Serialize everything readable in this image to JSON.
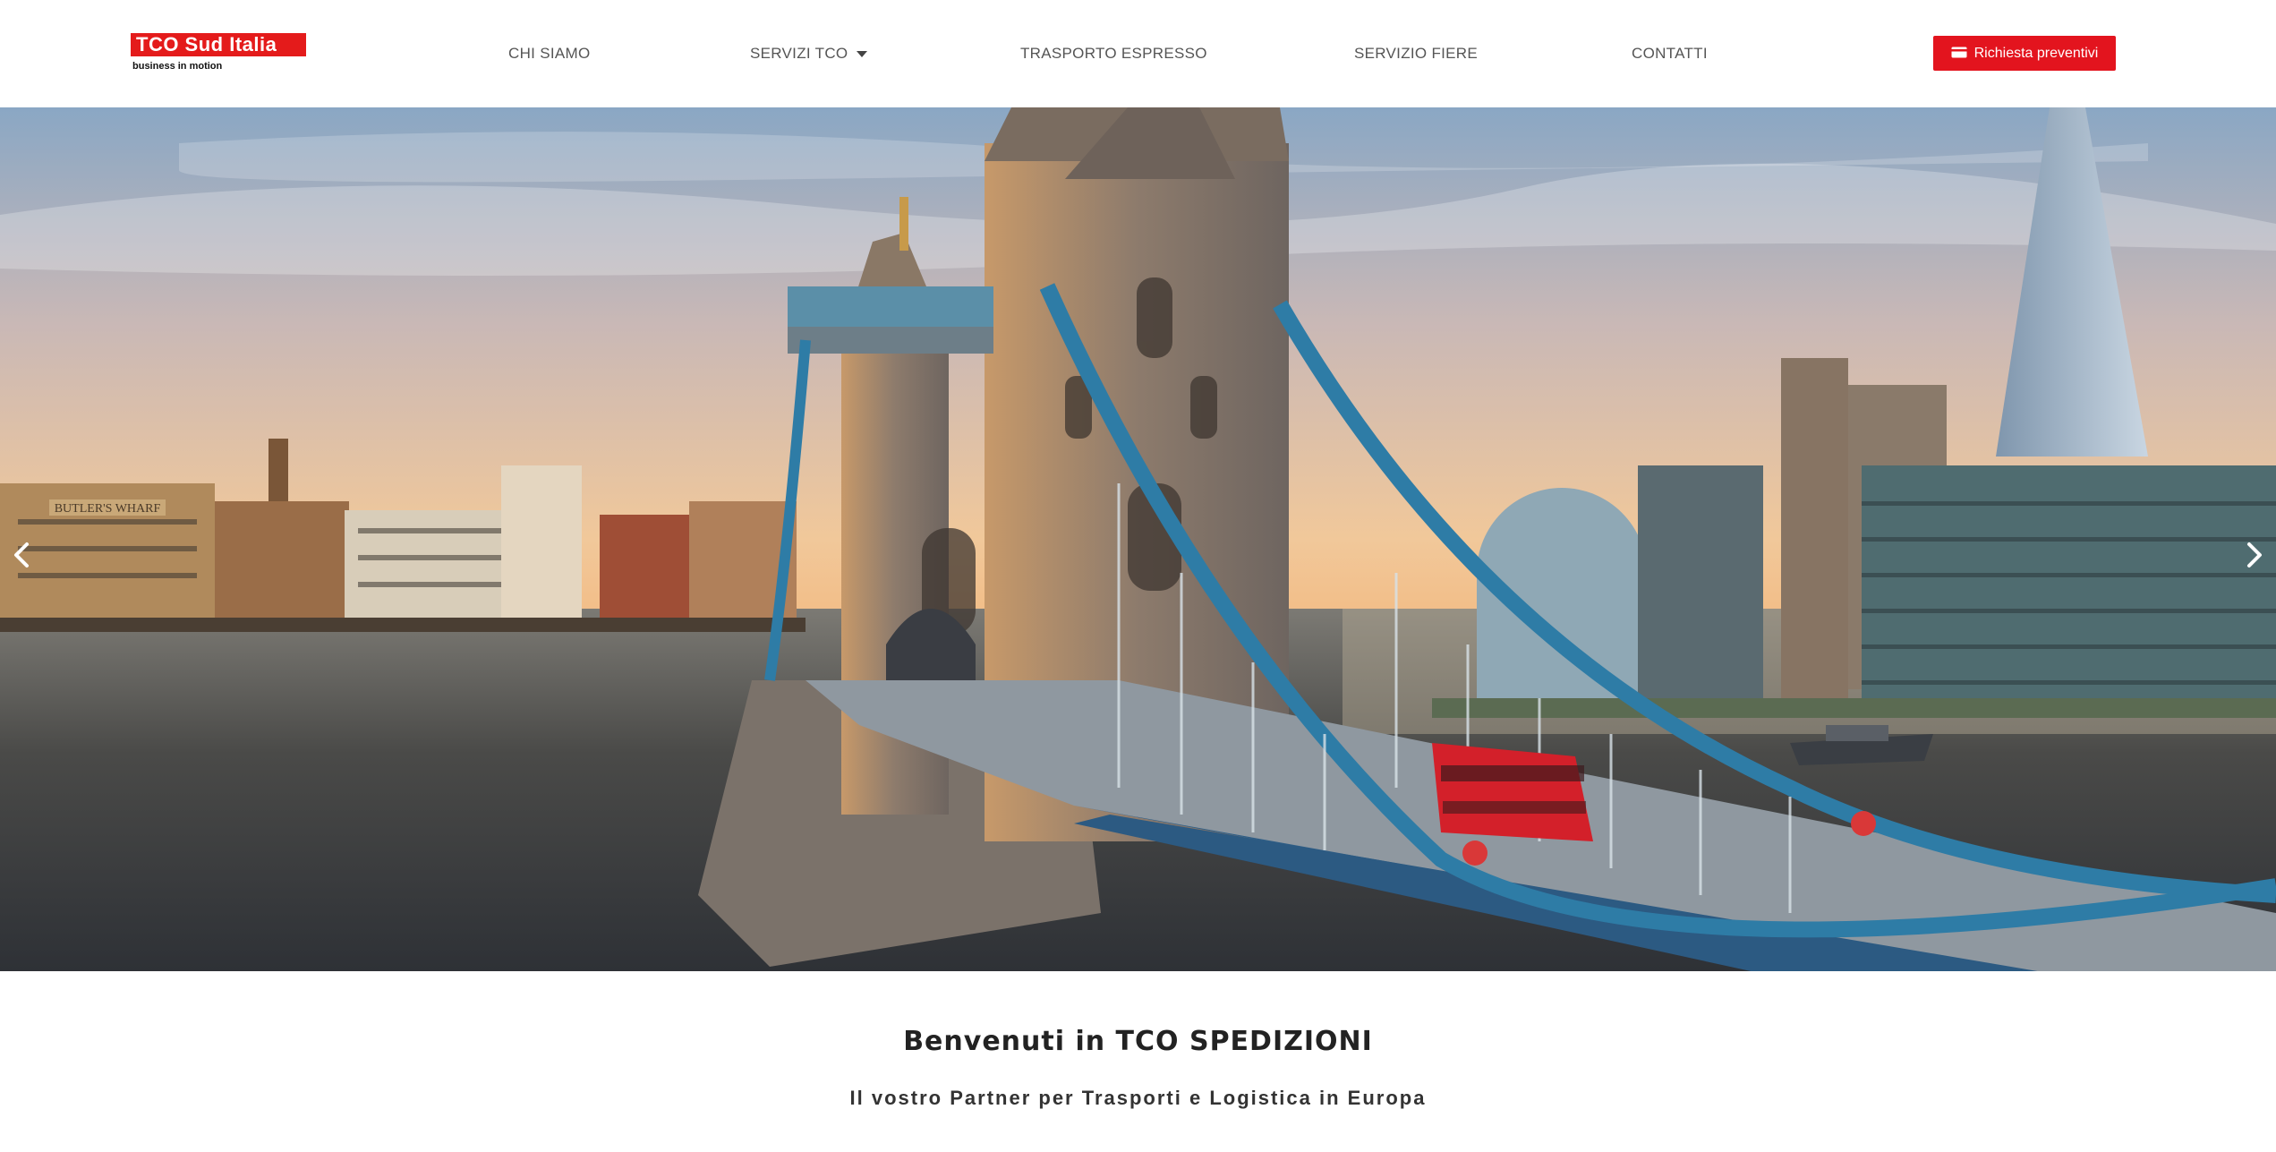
{
  "brand": {
    "logo_text": "TCO Sud Italia",
    "tagline": "business in motion",
    "accent_color": "#e3141e"
  },
  "nav": {
    "items": [
      {
        "label": "CHI SIAMO"
      },
      {
        "label": "SERVIZI TCO",
        "has_dropdown": true
      },
      {
        "label": "TRASPORTO ESPRESSO"
      },
      {
        "label": "SERVIZIO FIERE"
      },
      {
        "label": "CONTATTI"
      }
    ],
    "cta_label": "Richiesta preventivi",
    "cta_icon": "credit-card-icon"
  },
  "hero": {
    "image_text": "BUTLER'S WHARF",
    "prev_icon": "chevron-left-icon",
    "next_icon": "chevron-right-icon"
  },
  "intro": {
    "title": "Benvenuti in TCO SPEDIZIONI",
    "subtitle": "Il vostro Partner per Trasporti e Logistica in Europa"
  }
}
